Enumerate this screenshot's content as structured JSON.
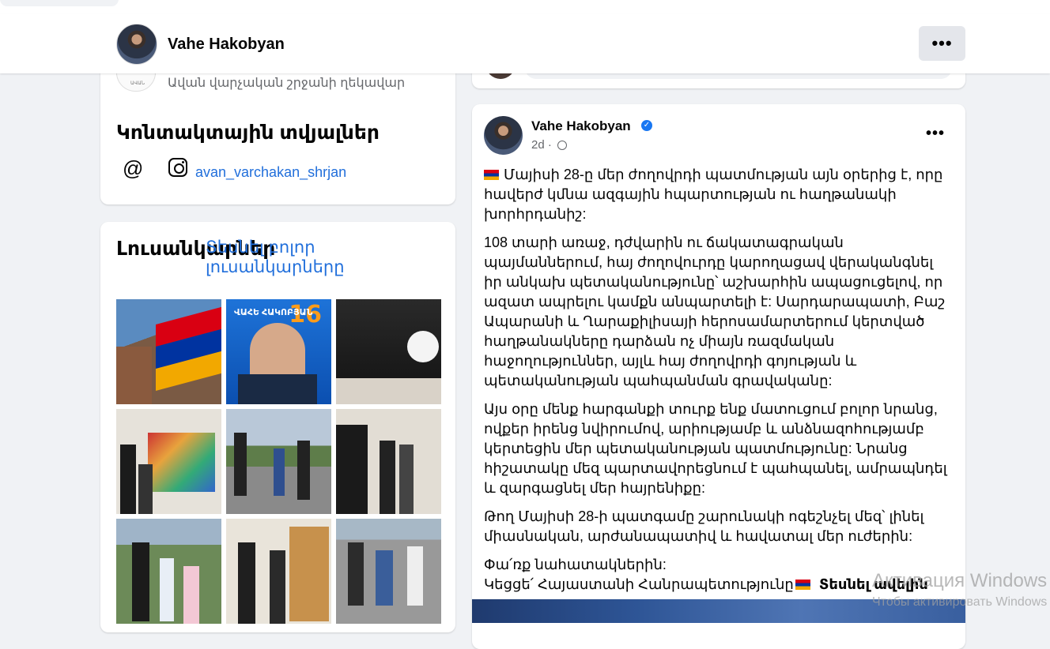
{
  "header": {
    "name": "Vahe Hakobyan",
    "more_label": "•••"
  },
  "intro": {
    "role": "Ավան վարչական շրջանի ղեկավար",
    "logo_text": "ԱՎԱՆ"
  },
  "contacts": {
    "title": "Կոնտակտային տվյալներ",
    "email_icon": "@",
    "instagram_handle": "avan_varchakan_shrjan"
  },
  "photos": {
    "title": "Լուսանկարներ",
    "see_all": "Տեսնել բոլոր լուսանկարները",
    "thumb_labels": {
      "poster_number": "16",
      "poster_name": "ՎԱՀԵ ՀԱԿՈԲՅԱՆ"
    }
  },
  "post": {
    "author": "Vahe Hakobyan",
    "verified": "✓",
    "age": "2d",
    "more_label": "•••",
    "paragraphs": [
      "Մայիսի 28-ը մեր ժողովրդի պատմության այն օրերից է, որը հավերժ կմնա ազգային հպարտության ու հաղթանակի խորհրդանիշ:",
      "108 տարի առաջ, դժվարին ու ճակատագրական պայմաններում, հայ ժողովուրդը կարողացավ վերականգնել իր անկախ պետականությունը՝ աշխարհին ապացուցելով, որ ազատ ապրելու կամքն անպարտելի է: Սարդարապատի, Բաշ Ապարանի և Ղարաքիլիսայի հերոսամարտերում կերտված հաղթանակները դարձան ոչ միայն ռազմական հաջողություններ, այլև հայ ժողովրդի գոյության և պետականության պահպանման գրավականը:",
      "Այս օրը մենք հարգանքի տուրք ենք մատուցում բոլոր նրանց, ովքեր իրենց նվիրումով, արիությամբ և անձնազոհությամբ կերտեցին մեր պետականության պատմությունը: Նրանց հիշատակը մեզ պարտավորեցնում է պահպանել, ամրապնդել և զարգացնել մեր հայրենիքը:",
      "Թող Մայիսի 28-ի պատգամը շարունակի ոգեշնչել մեզ՝ լինել միասնական, արժանապատիվ և հավատալ մեր ուժերին:"
    ],
    "closing_line1": "Փա՛ռք նահատակներին:",
    "closing_line2": "Կեցցե՛ Հայաստանի Հանրապետությունը",
    "see_more": "Տեսնել ավելին"
  },
  "watermark": {
    "line1": "Активация Windows",
    "line2": "Чтобы активировать Windows"
  },
  "colors": {
    "link": "#216fdb",
    "verified": "#1877f2",
    "page_bg": "#f0f2f5"
  }
}
